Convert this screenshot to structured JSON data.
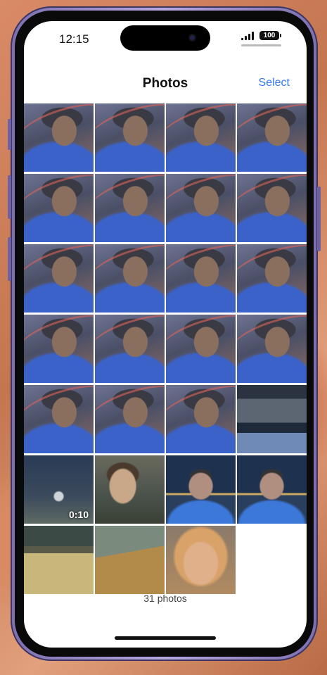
{
  "status_bar": {
    "time": "12:15",
    "battery": "100"
  },
  "nav": {
    "title": "Photos",
    "select_label": "Select"
  },
  "photos": [
    {
      "type": "selfie"
    },
    {
      "type": "selfie"
    },
    {
      "type": "selfie"
    },
    {
      "type": "selfie"
    },
    {
      "type": "selfie"
    },
    {
      "type": "selfie"
    },
    {
      "type": "selfie"
    },
    {
      "type": "selfie"
    },
    {
      "type": "selfie"
    },
    {
      "type": "selfie"
    },
    {
      "type": "selfie"
    },
    {
      "type": "selfie"
    },
    {
      "type": "selfie"
    },
    {
      "type": "selfie"
    },
    {
      "type": "selfie"
    },
    {
      "type": "selfie"
    },
    {
      "type": "selfie"
    },
    {
      "type": "selfie"
    },
    {
      "type": "selfie"
    },
    {
      "type": "car"
    },
    {
      "type": "night",
      "duration": "0:10"
    },
    {
      "type": "gamer"
    },
    {
      "type": "city"
    },
    {
      "type": "city"
    },
    {
      "type": "street"
    },
    {
      "type": "road"
    },
    {
      "type": "bear"
    }
  ],
  "footer": {
    "count_label": "31 photos"
  },
  "colors": {
    "accent": "#3478f6",
    "frame": "#b7a8e0"
  }
}
